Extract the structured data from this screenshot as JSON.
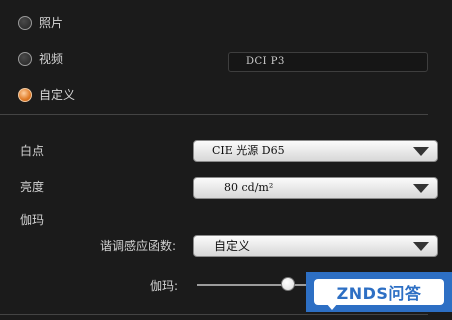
{
  "color_space": {
    "options": [
      {
        "label": "照片",
        "selected": false
      },
      {
        "label": "视频",
        "selected": false
      },
      {
        "label": "自定义",
        "selected": true
      }
    ],
    "preset_value": "DCI P3"
  },
  "white_point": {
    "label": "白点",
    "value": "CIE 光源 D65"
  },
  "brightness": {
    "label": "亮度",
    "value": "80 cd/m²"
  },
  "gamma": {
    "section_label": "伽玛",
    "tone_curve_label": "谐调感应函数:",
    "tone_curve_value": "自定义",
    "slider_label": "伽玛:",
    "slider_icon": "circle-thumb"
  },
  "watermark": {
    "text": "ZNDS问答",
    "color": "#2d6fc4"
  }
}
